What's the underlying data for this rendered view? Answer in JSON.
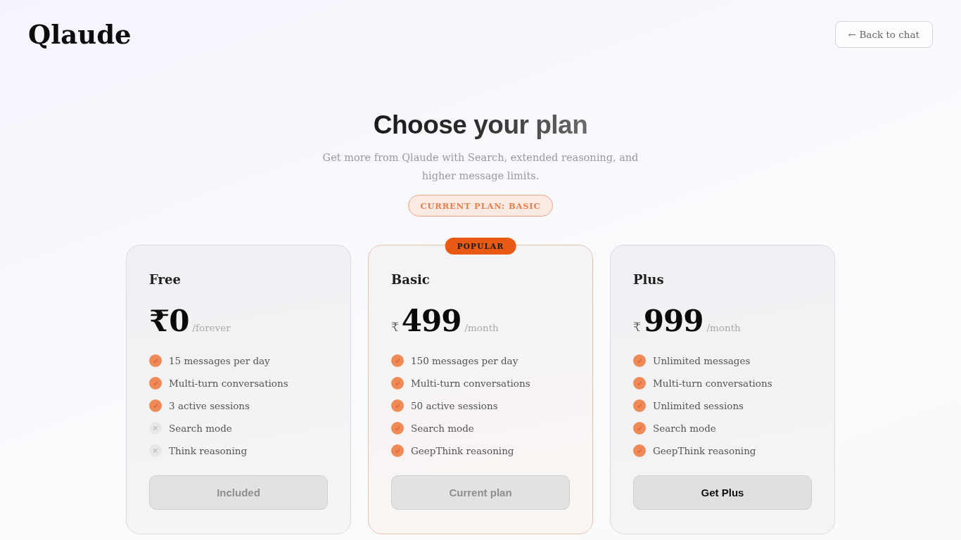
{
  "header": {
    "logo": "Qlaude",
    "back_button": "← Back to chat"
  },
  "hero": {
    "title": "Choose your plan",
    "subtitle": "Get more from Qlaude with Search, extended reasoning, and higher message limits.",
    "current_plan_badge": "CURRENT PLAN: BASIC"
  },
  "plans": [
    {
      "name": "Free",
      "highlighted": false,
      "price": {
        "amount": "₹0",
        "period": "/forever"
      },
      "features": [
        {
          "text": "15 messages per day",
          "included": true
        },
        {
          "text": "Multi-turn conversations",
          "included": true
        },
        {
          "text": "3 active sessions",
          "included": true
        },
        {
          "text": "Search mode",
          "included": false
        },
        {
          "text": "Think reasoning",
          "included": false
        }
      ],
      "button": {
        "label": "Included",
        "disabled": true
      }
    },
    {
      "name": "Basic",
      "badge": "POPULAR",
      "highlighted": true,
      "price": {
        "currency": "₹",
        "amount": "499",
        "period": "/month"
      },
      "features": [
        {
          "text": "150 messages per day",
          "included": true
        },
        {
          "text": "Multi-turn conversations",
          "included": true
        },
        {
          "text": "50 active sessions",
          "included": true
        },
        {
          "text": "Search mode",
          "included": true
        },
        {
          "text": "GeepThink reasoning",
          "included": true
        }
      ],
      "button": {
        "label": "Current plan",
        "disabled": true
      }
    },
    {
      "name": "Plus",
      "highlighted": false,
      "price": {
        "currency": "₹",
        "amount": "999",
        "period": "/month"
      },
      "features": [
        {
          "text": "Unlimited messages",
          "included": true
        },
        {
          "text": "Multi-turn conversations",
          "included": true
        },
        {
          "text": "Unlimited sessions",
          "included": true
        },
        {
          "text": "Search mode",
          "included": true
        },
        {
          "text": "GeepThink reasoning",
          "included": true
        }
      ],
      "button": {
        "label": "Get Plus",
        "disabled": false
      }
    }
  ]
}
